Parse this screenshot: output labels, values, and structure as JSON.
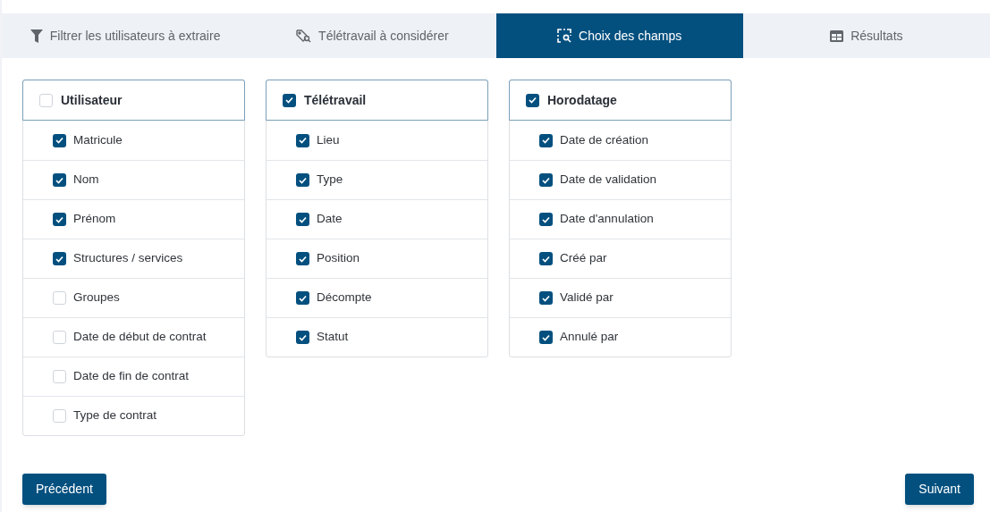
{
  "tabs": [
    {
      "label": "Filtrer les utilisateurs à extraire",
      "kind": "filter",
      "selected": false
    },
    {
      "label": "Télétravail à considérer",
      "kind": "tag",
      "selected": false
    },
    {
      "label": "Choix des champs",
      "kind": "select",
      "selected": true
    },
    {
      "label": "Résultats",
      "kind": "table",
      "selected": false
    }
  ],
  "groups": [
    {
      "title": "Utilisateur",
      "checked": false,
      "fields": [
        {
          "label": "Matricule",
          "checked": true
        },
        {
          "label": "Nom",
          "checked": true
        },
        {
          "label": "Prénom",
          "checked": true
        },
        {
          "label": "Structures / services",
          "checked": true
        },
        {
          "label": "Groupes",
          "checked": false
        },
        {
          "label": "Date de début de contrat",
          "checked": false
        },
        {
          "label": "Date de fin de contrat",
          "checked": false
        },
        {
          "label": "Type de contrat",
          "checked": false
        }
      ]
    },
    {
      "title": "Télétravail",
      "checked": true,
      "fields": [
        {
          "label": "Lieu",
          "checked": true
        },
        {
          "label": "Type",
          "checked": true
        },
        {
          "label": "Date",
          "checked": true
        },
        {
          "label": "Position",
          "checked": true
        },
        {
          "label": "Décompte",
          "checked": true
        },
        {
          "label": "Statut",
          "checked": true
        }
      ]
    },
    {
      "title": "Horodatage",
      "checked": true,
      "fields": [
        {
          "label": "Date de création",
          "checked": true
        },
        {
          "label": "Date de validation",
          "checked": true
        },
        {
          "label": "Date d'annulation",
          "checked": true
        },
        {
          "label": "Créé par",
          "checked": true
        },
        {
          "label": "Validé par",
          "checked": true
        },
        {
          "label": "Annulé par",
          "checked": true
        }
      ]
    }
  ],
  "buttons": {
    "previous": "Précédent",
    "next": "Suivant"
  }
}
